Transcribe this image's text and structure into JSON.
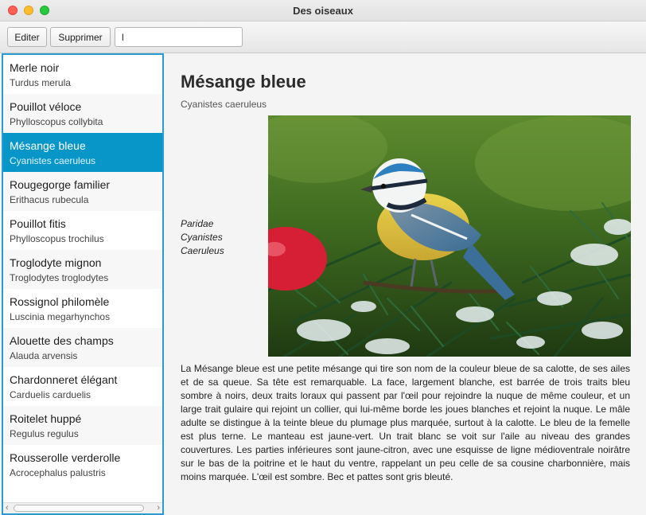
{
  "window": {
    "title": "Des oiseaux"
  },
  "toolbar": {
    "edit_label": "Editer",
    "delete_label": "Supprimer",
    "search_value": "l"
  },
  "sidebar": {
    "items": [
      {
        "name": "Merle noir",
        "latin": "Turdus merula"
      },
      {
        "name": "Pouillot véloce",
        "latin": "Phylloscopus collybita"
      },
      {
        "name": "Mésange bleue",
        "latin": "Cyanistes caeruleus"
      },
      {
        "name": "Rougegorge familier",
        "latin": "Erithacus rubecula"
      },
      {
        "name": "Pouillot fitis",
        "latin": "Phylloscopus trochilus"
      },
      {
        "name": "Troglodyte mignon",
        "latin": "Troglodytes troglodytes"
      },
      {
        "name": "Rossignol philomèle",
        "latin": "Luscinia megarhynchos"
      },
      {
        "name": "Alouette des champs",
        "latin": "Alauda arvensis"
      },
      {
        "name": "Chardonneret élégant",
        "latin": "Carduelis carduelis"
      },
      {
        "name": "Roitelet huppé",
        "latin": "Regulus regulus"
      },
      {
        "name": "Rousserolle verderolle",
        "latin": "Acrocephalus palustris"
      }
    ],
    "selected_index": 2
  },
  "detail": {
    "title": "Mésange bleue",
    "latin": "Cyanistes caeruleus",
    "family": "Paridae",
    "genus": "Cyanistes",
    "species": "Caeruleus",
    "description": "La Mésange bleue est une petite mésange qui tire son nom de la couleur bleue de sa calotte, de ses ailes et de sa queue. Sa tête est remarquable. La face, largement blanche, est barrée de trois traits bleu sombre à noirs, deux traits loraux qui passent par l'œil pour rejoindre la nuque de même couleur, et un large trait gulaire qui rejoint un collier, qui lui-même borde les joues blanches et rejoint la nuque. Le mâle adulte se distingue à la teinte bleue du plumage plus marquée, surtout à la calotte. Le bleu de la femelle est plus terne. Le manteau est jaune-vert. Un trait blanc se voit sur l'aile au niveau des grandes couvertures. Les parties inférieures sont jaune-citron, avec une esquisse de ligne médioventrale noirâtre sur le bas de la poitrine et le haut du ventre, rappelant un peu celle de sa cousine charbonnière, mais moins marquée. L'œil est sombre. Bec et pattes sont gris bleuté."
  },
  "colors": {
    "selection": "#0896c9",
    "list_border": "#2a9bd3"
  },
  "icons": [
    "scroll-left-arrow-icon",
    "scroll-right-arrow-icon"
  ]
}
